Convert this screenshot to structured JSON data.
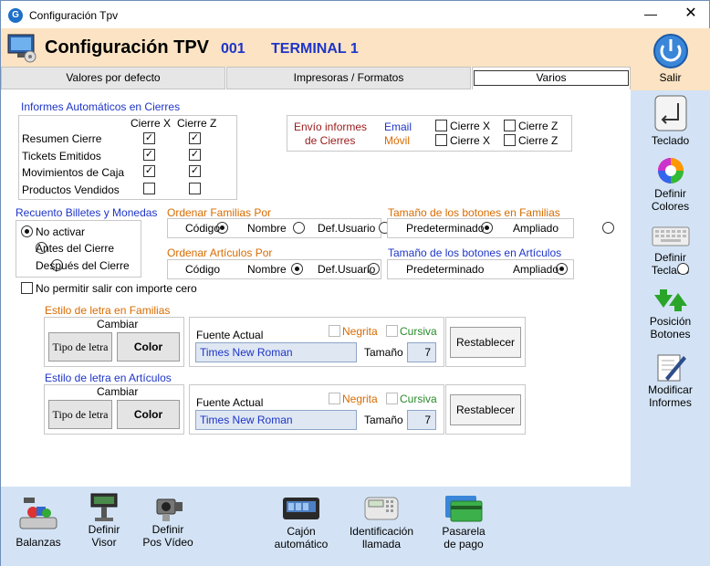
{
  "window": {
    "title": "Configuración Tpv",
    "minimize": "—",
    "close": "✕"
  },
  "header": {
    "title": "Configuración TPV",
    "number": "001",
    "terminal": "TERMINAL 1"
  },
  "tabs": [
    "Valores por defecto",
    "Impresoras / Formatos",
    "Varios"
  ],
  "sidebar": [
    "Salir",
    "Teclado",
    "Definir Colores",
    "Definir Teclado",
    "Posición Botones",
    "Modificar Informes"
  ],
  "informes": {
    "title": "Informes Automáticos en Cierres",
    "col_x": "Cierre X",
    "col_z": "Cierre Z",
    "rows": [
      {
        "label": "Resumen Cierre",
        "x": "✓",
        "z": "✓"
      },
      {
        "label": "Tickets Emitidos",
        "x": "✓",
        "z": "✓"
      },
      {
        "label": "Movimientos de Caja",
        "x": "✓",
        "z": "✓"
      },
      {
        "label": "Productos Vendidos",
        "x": "",
        "z": ""
      }
    ]
  },
  "envio": {
    "title1": "Envío informes",
    "title2": "de Cierres",
    "email": "Email",
    "movil": "Móvil",
    "cierre_x": "Cierre X",
    "cierre_z": "Cierre Z"
  },
  "recuento": {
    "title": "Recuento Billetes y Monedas",
    "options": [
      "No activar",
      "Antes del Cierre",
      "Después del Cierre"
    ],
    "selected": "No activar"
  },
  "ordenar_familias": {
    "title": "Ordenar Familias Por",
    "options": [
      "Código",
      "Nombre",
      "Def.Usuario"
    ]
  },
  "ordenar_articulos": {
    "title": "Ordenar Artículos Por",
    "options": [
      "Código",
      "Nombre",
      "Def.Usuario"
    ]
  },
  "tam_familias": {
    "title": "Tamaño de los botones en Familias",
    "options": [
      "Predeterminado",
      "Ampliado"
    ]
  },
  "tam_articulos": {
    "title": "Tamaño de los botones en Artículos",
    "options": [
      "Predeterminado",
      "Ampliado"
    ]
  },
  "no_permitir": "No permitir salir con importe cero",
  "estilo_familias": {
    "title": "Estilo de letra en Familias",
    "cambiar": "Cambiar",
    "tipo": "Tipo de letra",
    "color": "Color",
    "fuente_label": "Fuente Actual",
    "fuente": "Times New Roman",
    "negrita": "Negrita",
    "cursiva": "Cursiva",
    "tamano_label": "Tamaño",
    "tamano": "7",
    "restablecer": "Restablecer"
  },
  "estilo_articulos": {
    "title": "Estilo de letra en Artículos",
    "cambiar": "Cambiar",
    "tipo": "Tipo de letra",
    "color": "Color",
    "fuente_label": "Fuente Actual",
    "fuente": "Times New Roman",
    "negrita": "Negrita",
    "cursiva": "Cursiva",
    "tamano_label": "Tamaño",
    "tamano": "7",
    "restablecer": "Restablecer"
  },
  "bottom": [
    {
      "l1": "",
      "l2": "Balanzas"
    },
    {
      "l1": "Definir",
      "l2": "Visor"
    },
    {
      "l1": "Definir",
      "l2": "Pos Vídeo"
    },
    {
      "l1": "Cajón",
      "l2": "automático"
    },
    {
      "l1": "Identificación",
      "l2": "llamada"
    },
    {
      "l1": "Pasarela",
      "l2": "de pago"
    }
  ]
}
